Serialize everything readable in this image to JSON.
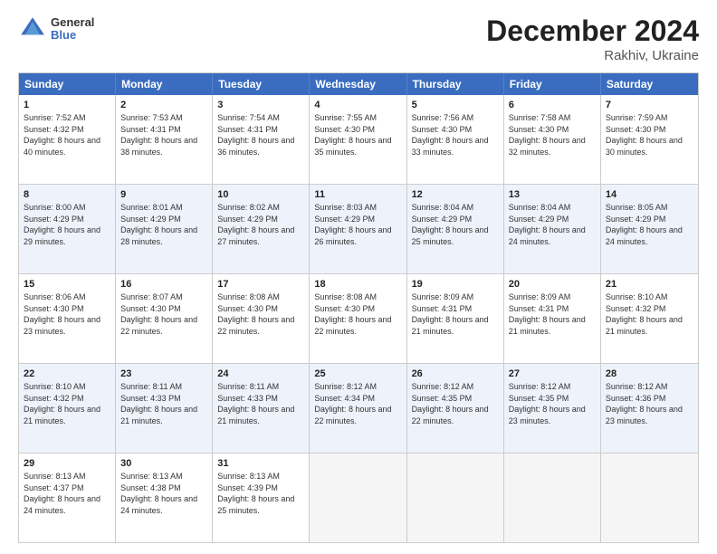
{
  "logo": {
    "text1": "General",
    "text2": "Blue"
  },
  "header": {
    "title": "December 2024",
    "location": "Rakhiv, Ukraine"
  },
  "days": [
    "Sunday",
    "Monday",
    "Tuesday",
    "Wednesday",
    "Thursday",
    "Friday",
    "Saturday"
  ],
  "rows": [
    [
      {
        "day": "1",
        "sunrise": "Sunrise: 7:52 AM",
        "sunset": "Sunset: 4:32 PM",
        "daylight": "Daylight: 8 hours and 40 minutes."
      },
      {
        "day": "2",
        "sunrise": "Sunrise: 7:53 AM",
        "sunset": "Sunset: 4:31 PM",
        "daylight": "Daylight: 8 hours and 38 minutes."
      },
      {
        "day": "3",
        "sunrise": "Sunrise: 7:54 AM",
        "sunset": "Sunset: 4:31 PM",
        "daylight": "Daylight: 8 hours and 36 minutes."
      },
      {
        "day": "4",
        "sunrise": "Sunrise: 7:55 AM",
        "sunset": "Sunset: 4:30 PM",
        "daylight": "Daylight: 8 hours and 35 minutes."
      },
      {
        "day": "5",
        "sunrise": "Sunrise: 7:56 AM",
        "sunset": "Sunset: 4:30 PM",
        "daylight": "Daylight: 8 hours and 33 minutes."
      },
      {
        "day": "6",
        "sunrise": "Sunrise: 7:58 AM",
        "sunset": "Sunset: 4:30 PM",
        "daylight": "Daylight: 8 hours and 32 minutes."
      },
      {
        "day": "7",
        "sunrise": "Sunrise: 7:59 AM",
        "sunset": "Sunset: 4:30 PM",
        "daylight": "Daylight: 8 hours and 30 minutes."
      }
    ],
    [
      {
        "day": "8",
        "sunrise": "Sunrise: 8:00 AM",
        "sunset": "Sunset: 4:29 PM",
        "daylight": "Daylight: 8 hours and 29 minutes."
      },
      {
        "day": "9",
        "sunrise": "Sunrise: 8:01 AM",
        "sunset": "Sunset: 4:29 PM",
        "daylight": "Daylight: 8 hours and 28 minutes."
      },
      {
        "day": "10",
        "sunrise": "Sunrise: 8:02 AM",
        "sunset": "Sunset: 4:29 PM",
        "daylight": "Daylight: 8 hours and 27 minutes."
      },
      {
        "day": "11",
        "sunrise": "Sunrise: 8:03 AM",
        "sunset": "Sunset: 4:29 PM",
        "daylight": "Daylight: 8 hours and 26 minutes."
      },
      {
        "day": "12",
        "sunrise": "Sunrise: 8:04 AM",
        "sunset": "Sunset: 4:29 PM",
        "daylight": "Daylight: 8 hours and 25 minutes."
      },
      {
        "day": "13",
        "sunrise": "Sunrise: 8:04 AM",
        "sunset": "Sunset: 4:29 PM",
        "daylight": "Daylight: 8 hours and 24 minutes."
      },
      {
        "day": "14",
        "sunrise": "Sunrise: 8:05 AM",
        "sunset": "Sunset: 4:29 PM",
        "daylight": "Daylight: 8 hours and 24 minutes."
      }
    ],
    [
      {
        "day": "15",
        "sunrise": "Sunrise: 8:06 AM",
        "sunset": "Sunset: 4:30 PM",
        "daylight": "Daylight: 8 hours and 23 minutes."
      },
      {
        "day": "16",
        "sunrise": "Sunrise: 8:07 AM",
        "sunset": "Sunset: 4:30 PM",
        "daylight": "Daylight: 8 hours and 22 minutes."
      },
      {
        "day": "17",
        "sunrise": "Sunrise: 8:08 AM",
        "sunset": "Sunset: 4:30 PM",
        "daylight": "Daylight: 8 hours and 22 minutes."
      },
      {
        "day": "18",
        "sunrise": "Sunrise: 8:08 AM",
        "sunset": "Sunset: 4:30 PM",
        "daylight": "Daylight: 8 hours and 22 minutes."
      },
      {
        "day": "19",
        "sunrise": "Sunrise: 8:09 AM",
        "sunset": "Sunset: 4:31 PM",
        "daylight": "Daylight: 8 hours and 21 minutes."
      },
      {
        "day": "20",
        "sunrise": "Sunrise: 8:09 AM",
        "sunset": "Sunset: 4:31 PM",
        "daylight": "Daylight: 8 hours and 21 minutes."
      },
      {
        "day": "21",
        "sunrise": "Sunrise: 8:10 AM",
        "sunset": "Sunset: 4:32 PM",
        "daylight": "Daylight: 8 hours and 21 minutes."
      }
    ],
    [
      {
        "day": "22",
        "sunrise": "Sunrise: 8:10 AM",
        "sunset": "Sunset: 4:32 PM",
        "daylight": "Daylight: 8 hours and 21 minutes."
      },
      {
        "day": "23",
        "sunrise": "Sunrise: 8:11 AM",
        "sunset": "Sunset: 4:33 PM",
        "daylight": "Daylight: 8 hours and 21 minutes."
      },
      {
        "day": "24",
        "sunrise": "Sunrise: 8:11 AM",
        "sunset": "Sunset: 4:33 PM",
        "daylight": "Daylight: 8 hours and 21 minutes."
      },
      {
        "day": "25",
        "sunrise": "Sunrise: 8:12 AM",
        "sunset": "Sunset: 4:34 PM",
        "daylight": "Daylight: 8 hours and 22 minutes."
      },
      {
        "day": "26",
        "sunrise": "Sunrise: 8:12 AM",
        "sunset": "Sunset: 4:35 PM",
        "daylight": "Daylight: 8 hours and 22 minutes."
      },
      {
        "day": "27",
        "sunrise": "Sunrise: 8:12 AM",
        "sunset": "Sunset: 4:35 PM",
        "daylight": "Daylight: 8 hours and 23 minutes."
      },
      {
        "day": "28",
        "sunrise": "Sunrise: 8:12 AM",
        "sunset": "Sunset: 4:36 PM",
        "daylight": "Daylight: 8 hours and 23 minutes."
      }
    ],
    [
      {
        "day": "29",
        "sunrise": "Sunrise: 8:13 AM",
        "sunset": "Sunset: 4:37 PM",
        "daylight": "Daylight: 8 hours and 24 minutes."
      },
      {
        "day": "30",
        "sunrise": "Sunrise: 8:13 AM",
        "sunset": "Sunset: 4:38 PM",
        "daylight": "Daylight: 8 hours and 24 minutes."
      },
      {
        "day": "31",
        "sunrise": "Sunrise: 8:13 AM",
        "sunset": "Sunset: 4:39 PM",
        "daylight": "Daylight: 8 hours and 25 minutes."
      },
      null,
      null,
      null,
      null
    ]
  ],
  "alt_rows": [
    1,
    3
  ]
}
